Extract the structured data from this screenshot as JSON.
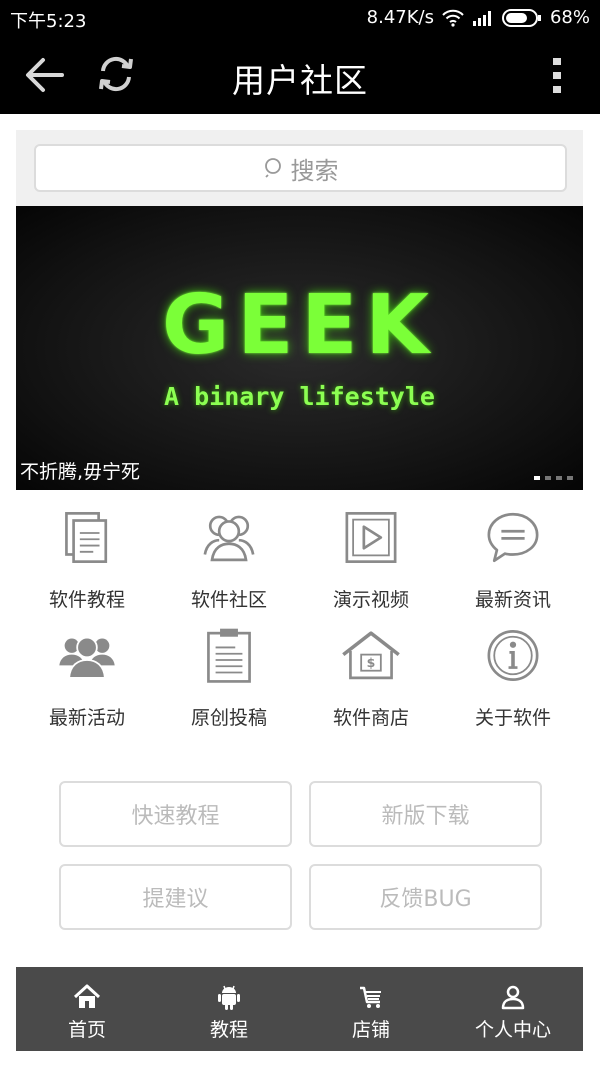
{
  "status_bar": {
    "time": "下午5:23",
    "speed": "8.47K/s",
    "battery": "68%"
  },
  "header": {
    "title": "用户社区"
  },
  "search": {
    "placeholder": "搜索"
  },
  "banner": {
    "headline": "GEEK",
    "tagline": "A binary lifestyle",
    "caption": "不折腾,毋宁死"
  },
  "grid": [
    {
      "label": "软件教程",
      "icon": "document-copy-icon"
    },
    {
      "label": "软件社区",
      "icon": "community-people-icon"
    },
    {
      "label": "演示视频",
      "icon": "video-play-icon"
    },
    {
      "label": "最新资讯",
      "icon": "chat-bubble-icon"
    },
    {
      "label": "最新活动",
      "icon": "group-people-icon"
    },
    {
      "label": "原创投稿",
      "icon": "clipboard-icon"
    },
    {
      "label": "软件商店",
      "icon": "store-house-icon"
    },
    {
      "label": "关于软件",
      "icon": "info-circle-icon"
    }
  ],
  "buttons": {
    "quick_tutorial": "快速教程",
    "new_download": "新版下载",
    "suggestion": "提建议",
    "feedback": "反馈BUG"
  },
  "bottom_nav": [
    {
      "label": "首页",
      "icon": "home-icon"
    },
    {
      "label": "教程",
      "icon": "android-icon"
    },
    {
      "label": "店铺",
      "icon": "cart-icon"
    },
    {
      "label": "个人中心",
      "icon": "person-icon"
    }
  ],
  "colors": {
    "status_bg": "#000000",
    "banner_green": "#7bff38",
    "nav_bg": "#4a4a4a",
    "icon_gray": "#8a8a8a"
  }
}
